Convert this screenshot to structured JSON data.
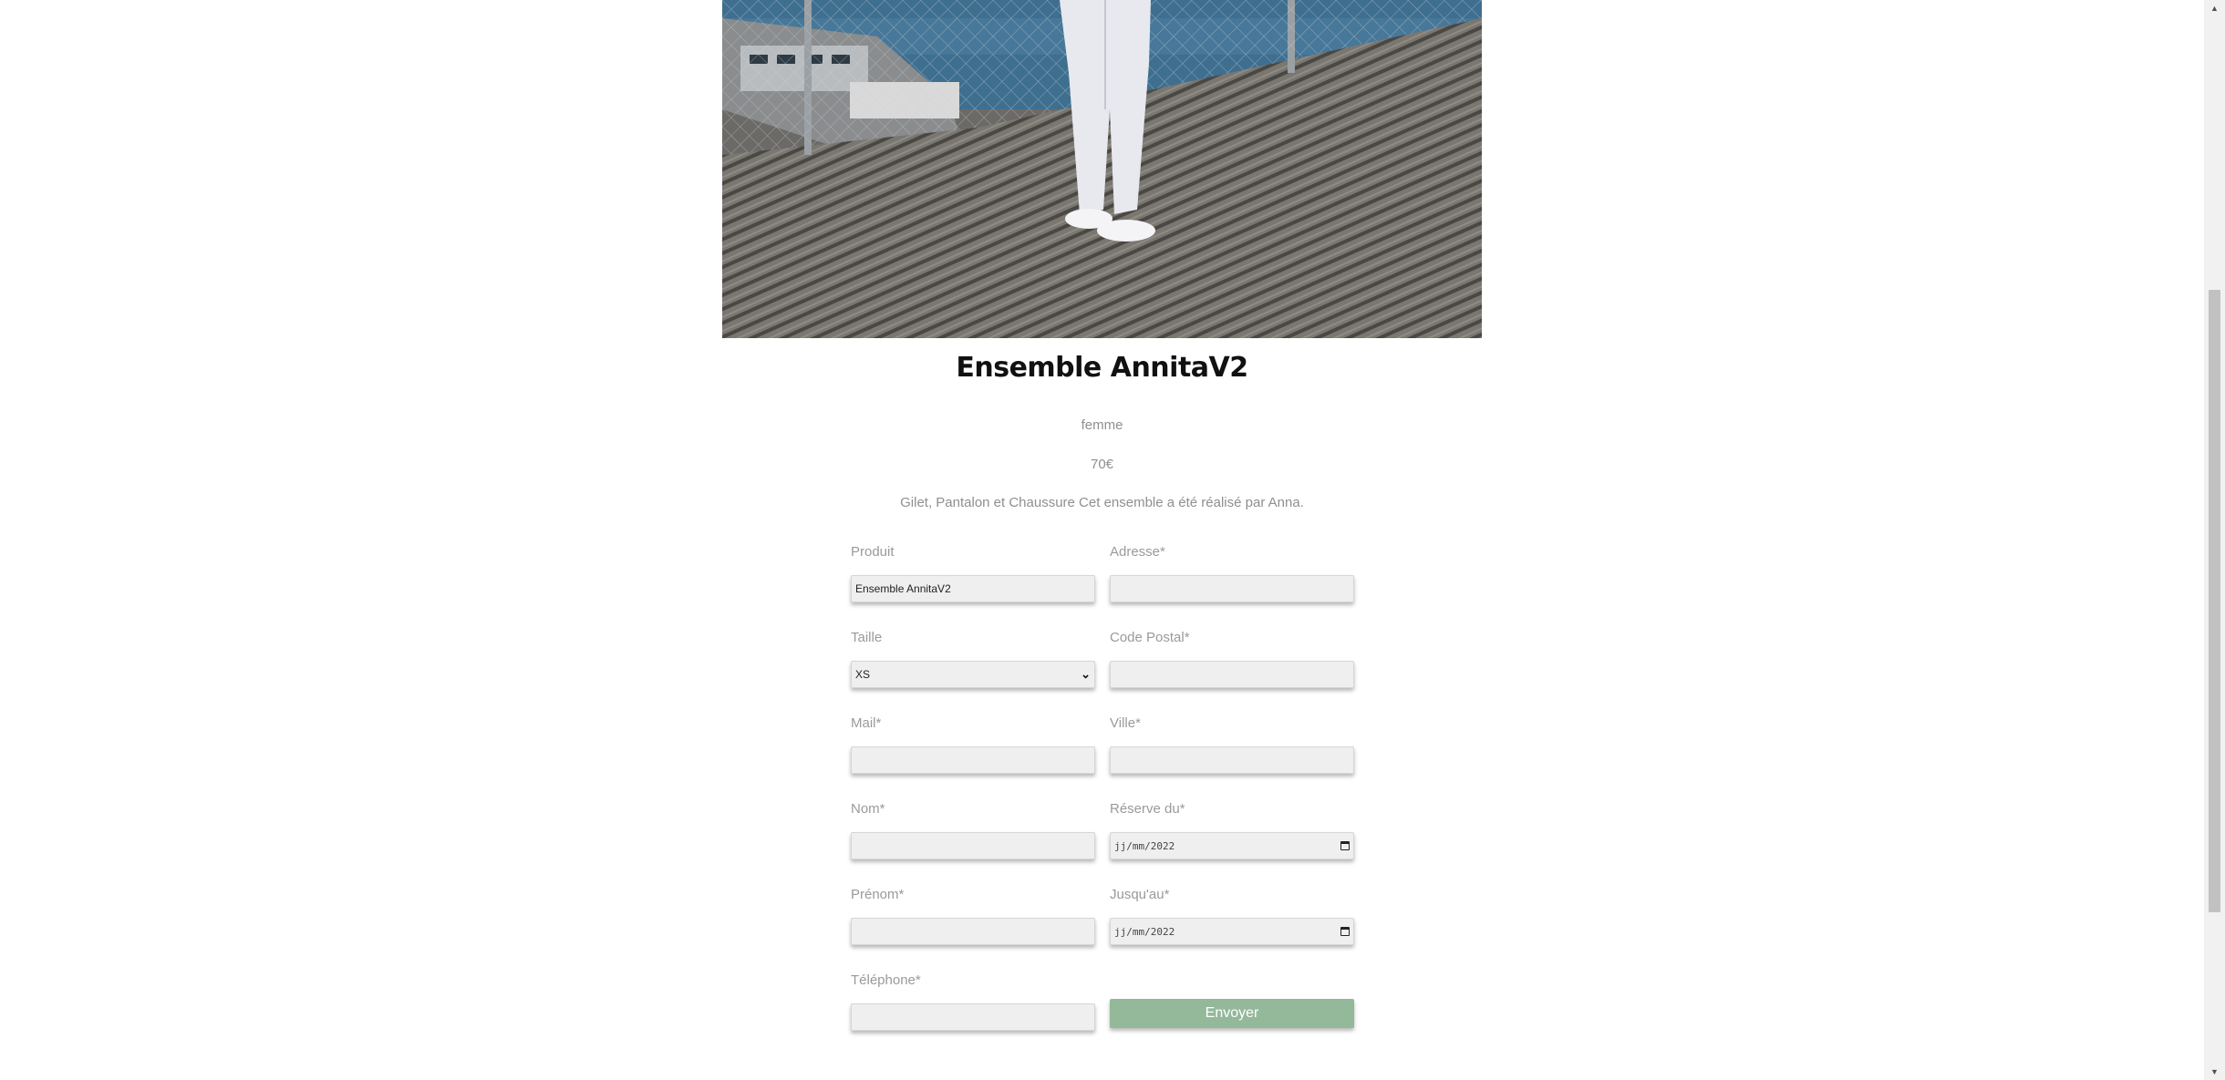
{
  "product": {
    "title": "Ensemble AnnitaV2",
    "category": "femme",
    "price": "70€",
    "description": "Gilet, Pantalon et Chaussure Cet ensemble a été réalisé par Anna."
  },
  "form": {
    "produit": {
      "label": "Produit",
      "value": "Ensemble AnnitaV2"
    },
    "taille": {
      "label": "Taille",
      "value": "XS"
    },
    "mail": {
      "label": "Mail*",
      "value": ""
    },
    "nom": {
      "label": "Nom*",
      "value": ""
    },
    "prenom": {
      "label": "Prénom*",
      "value": ""
    },
    "telephone": {
      "label": "Téléphone*",
      "value": ""
    },
    "adresse": {
      "label": "Adresse*",
      "value": ""
    },
    "code_postal": {
      "label": "Code Postal*",
      "value": ""
    },
    "ville": {
      "label": "Ville*",
      "value": ""
    },
    "reserve_du": {
      "label": "Réserve du*",
      "value": "jj/mm/2022"
    },
    "jusqu_au": {
      "label": "Jusqu'au*",
      "value": "jj/mm/2022"
    },
    "submit_label": "Envoyer"
  },
  "icons": {
    "select_chevron": "chevron-down-icon",
    "calendar": "calendar-icon",
    "scroll_up": "scroll-up-arrow-icon",
    "scroll_down": "scroll-down-arrow-icon"
  },
  "colors": {
    "submit_button": "#94b89a",
    "title": "#111111",
    "field_background": "#efefef"
  }
}
